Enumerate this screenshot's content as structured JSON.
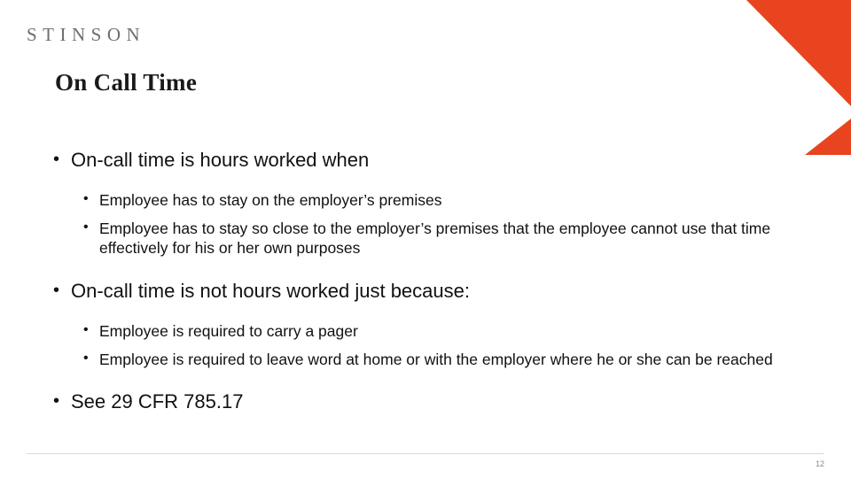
{
  "brand": {
    "logo_text": "STINSON",
    "accent_color": "#E8441F",
    "logo_color": "#6E6E6E"
  },
  "slide": {
    "title": "On Call Time",
    "page_number": "12",
    "blocks": [
      {
        "level": 1,
        "bullet": "•",
        "text": "On-call time is hours worked when"
      },
      {
        "level": 2,
        "bullet": "•",
        "text": "Employee has to stay on the employer’s premises"
      },
      {
        "level": 2,
        "bullet": "•",
        "text": "Employee has to stay so close to the employer’s premises that the employee cannot use that time effectively for his or her own purposes"
      },
      {
        "level": 1,
        "bullet": "•",
        "text": "On-call time is not hours worked just because:"
      },
      {
        "level": 2,
        "bullet": "•",
        "text": "Employee is required to carry a pager"
      },
      {
        "level": 2,
        "bullet": "•",
        "text": "Employee is required to leave word at home or with the employer where he or she can be reached"
      },
      {
        "level": 1,
        "bullet": "•",
        "text": "See 29 CFR 785.17"
      }
    ]
  }
}
